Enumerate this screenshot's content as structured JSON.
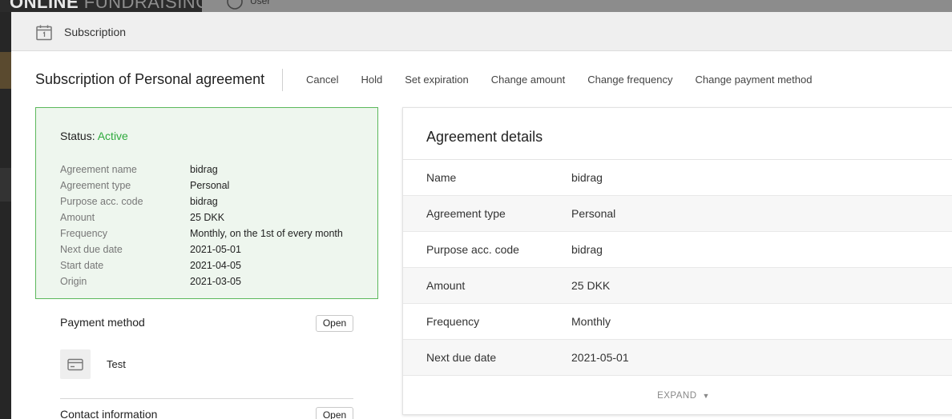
{
  "background": {
    "brand_strong": "ONLINE",
    "brand_light": "FUNDRAISING",
    "user_label": "User"
  },
  "modal": {
    "title": "Subscription",
    "icon": "calendar-icon"
  },
  "page": {
    "title": "Subscription of Personal agreement",
    "actions": [
      "Cancel",
      "Hold",
      "Set expiration",
      "Change amount",
      "Change frequency",
      "Change payment method"
    ]
  },
  "status_card": {
    "status_label": "Status:",
    "status_value": "Active",
    "status_color": "#2eaa3c",
    "rows": [
      {
        "label": "Agreement name",
        "value": "bidrag"
      },
      {
        "label": "Agreement type",
        "value": "Personal"
      },
      {
        "label": "Purpose acc. code",
        "value": "bidrag"
      },
      {
        "label": "Amount",
        "value": "25 DKK"
      },
      {
        "label": "Frequency",
        "value": "Monthly, on the 1st of every month"
      },
      {
        "label": "Next due date",
        "value": "2021-05-01"
      },
      {
        "label": "Start date",
        "value": "2021-04-05"
      },
      {
        "label": "Origin",
        "value": "2021-03-05"
      }
    ]
  },
  "payment_method": {
    "heading": "Payment method",
    "open_label": "Open",
    "icon": "credit-card-icon",
    "name": "Test"
  },
  "contact_information": {
    "heading": "Contact information",
    "open_label": "Open"
  },
  "details": {
    "title": "Agreement details",
    "rows": [
      {
        "label": "Name",
        "value": "bidrag"
      },
      {
        "label": "Agreement type",
        "value": "Personal"
      },
      {
        "label": "Purpose acc. code",
        "value": "bidrag"
      },
      {
        "label": "Amount",
        "value": "25 DKK"
      },
      {
        "label": "Frequency",
        "value": "Monthly"
      },
      {
        "label": "Next due date",
        "value": "2021-05-01"
      }
    ],
    "expand_label": "EXPAND"
  }
}
